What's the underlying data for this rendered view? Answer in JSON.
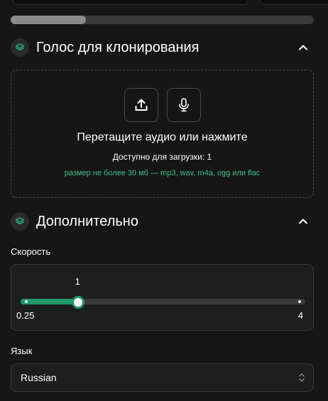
{
  "voice_section": {
    "title": "Голос для клонирования",
    "icon": "layers-icon",
    "dropzone": {
      "upload_icon": "upload-icon",
      "mic_icon": "microphone-icon",
      "prompt": "Перетащите аудио или нажмите",
      "available": "Доступно для загрузки: 1",
      "limits": "размер не более 30 мб — mp3, wav, m4a, ogg или flac"
    }
  },
  "advanced_section": {
    "title": "Дополнительно",
    "icon": "layers-icon",
    "speed": {
      "label": "Скорость",
      "value": "1",
      "min": "0.25",
      "max": "4",
      "value_num": 1,
      "min_num": 0.25,
      "max_num": 4
    },
    "language": {
      "label": "Язык",
      "selected": "Russian"
    }
  },
  "colors": {
    "accent": "#1f9a69",
    "accent_text": "#3fc08a",
    "background": "#161616"
  }
}
